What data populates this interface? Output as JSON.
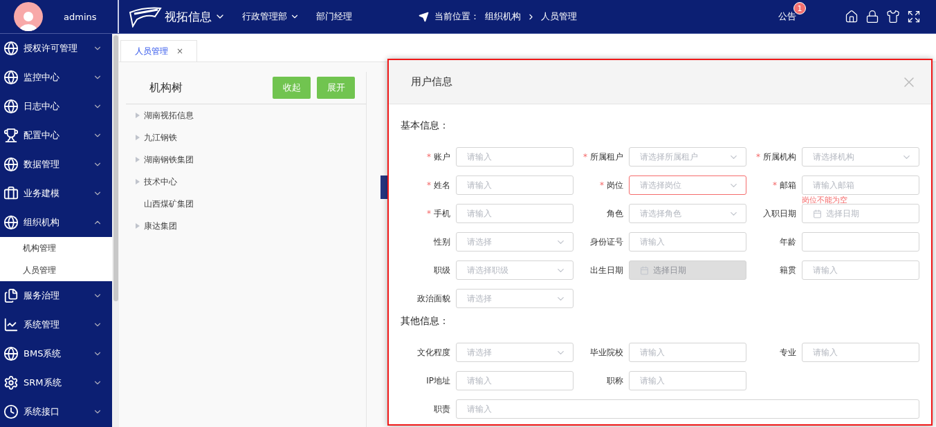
{
  "header": {
    "user": "admins",
    "brand": "视拓信息",
    "department": "行政管理部",
    "role": "部门经理",
    "breadcrumb_label": "当前位置：",
    "breadcrumb": [
      "组织机构",
      "人员管理"
    ],
    "notice": "公告",
    "notice_count": "1"
  },
  "sidebar": {
    "items": [
      {
        "label": "授权许可管理",
        "expanded": false
      },
      {
        "label": "监控中心",
        "expanded": false
      },
      {
        "label": "日志中心",
        "expanded": false
      },
      {
        "label": "配置中心",
        "expanded": false
      },
      {
        "label": "数据管理",
        "expanded": false
      },
      {
        "label": "业务建模",
        "expanded": false
      },
      {
        "label": "组织机构",
        "expanded": true,
        "children": [
          {
            "label": "机构管理"
          },
          {
            "label": "人员管理"
          }
        ]
      },
      {
        "label": "服务治理",
        "expanded": false
      },
      {
        "label": "系统管理",
        "expanded": false
      },
      {
        "label": "BMS系统",
        "expanded": false
      },
      {
        "label": "SRM系统",
        "expanded": false
      },
      {
        "label": "系统接口",
        "expanded": false
      }
    ]
  },
  "tabs": [
    {
      "label": "人员管理",
      "close": "×",
      "selected": true
    }
  ],
  "tree_panel": {
    "title": "机构树",
    "buttons": [
      "收起",
      "展开"
    ],
    "nodes": [
      {
        "label": "湖南视拓信息",
        "expandable": true
      },
      {
        "label": "九江钢铁",
        "expandable": true
      },
      {
        "label": "湖南钢铁集团",
        "expandable": true
      },
      {
        "label": "技术中心",
        "expandable": true
      },
      {
        "label": "山西煤矿集团",
        "expandable": false
      },
      {
        "label": "康达集团",
        "expandable": true
      }
    ]
  },
  "dialog": {
    "title": "用户信息",
    "sections": [
      {
        "title": "基本信息：",
        "fields": [
          {
            "label": "账户",
            "kind": "input",
            "required_mark": "*",
            "placeholder": "请输入"
          },
          {
            "label": "所属租户",
            "kind": "select",
            "required_mark": "*",
            "placeholder": "请选择所属租户"
          },
          {
            "label": "所属机构",
            "kind": "select",
            "required_mark": "*",
            "placeholder": "请选择机构"
          },
          {
            "label": "姓名",
            "kind": "input",
            "required_mark": "*",
            "placeholder": "请输入"
          },
          {
            "label": "岗位",
            "kind": "select",
            "required_mark": "*",
            "placeholder": "请选择岗位",
            "error": "岗位不能为空"
          },
          {
            "label": "邮箱",
            "kind": "input",
            "required_mark": "*",
            "placeholder": "请输入邮箱"
          },
          {
            "label": "手机",
            "kind": "input",
            "required_mark": "*",
            "placeholder": "请输入"
          },
          {
            "label": "角色",
            "kind": "select",
            "placeholder": "请选择角色"
          },
          {
            "label": "入职日期",
            "kind": "date",
            "placeholder": "选择日期"
          },
          {
            "label": "性别",
            "kind": "select",
            "placeholder": "请选择"
          },
          {
            "label": "身份证号",
            "kind": "input",
            "placeholder": "请输入"
          },
          {
            "label": "年龄",
            "kind": "input"
          },
          {
            "label": "职级",
            "kind": "select",
            "placeholder": "请选择职级"
          },
          {
            "label": "出生日期",
            "kind": "date",
            "placeholder": "选择日期",
            "disabled": true
          },
          {
            "label": "籍贯",
            "kind": "input",
            "placeholder": "请输入"
          },
          {
            "label": "政治面貌",
            "kind": "select",
            "placeholder": "请选择"
          }
        ]
      },
      {
        "title": "其他信息：",
        "fields": [
          {
            "label": "文化程度",
            "kind": "select",
            "placeholder": "请选择"
          },
          {
            "label": "毕业院校",
            "kind": "input",
            "placeholder": "请输入"
          },
          {
            "label": "专业",
            "kind": "input",
            "placeholder": "请输入"
          },
          {
            "label": "IP地址",
            "kind": "input",
            "placeholder": "请输入"
          },
          {
            "label": "职称",
            "kind": "input",
            "placeholder": "请输入"
          },
          {
            "label": "职责",
            "kind": "wide",
            "placeholder": "请输入"
          }
        ]
      }
    ]
  }
}
